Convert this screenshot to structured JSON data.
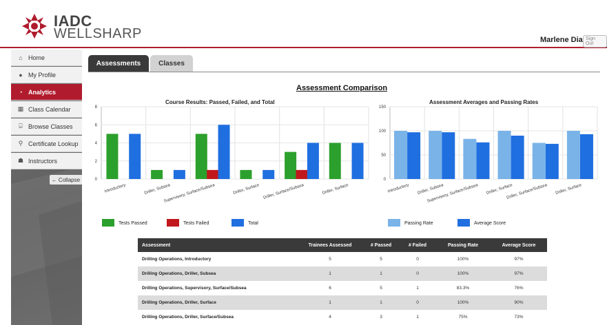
{
  "brand": {
    "line1": "IADC",
    "line2": "WELLSHARP",
    "accent": "#b01c2e"
  },
  "user": {
    "name": "Marlene Diaz",
    "signout": "Sign Out"
  },
  "sidebar": {
    "items": [
      {
        "label": "Home",
        "icon": "home-icon"
      },
      {
        "label": "My Profile",
        "icon": "user-icon"
      },
      {
        "label": "Analytics",
        "icon": "analytics-icon",
        "active": true
      },
      {
        "label": "Class Calendar",
        "icon": "calendar-icon"
      },
      {
        "label": "Browse Classes",
        "icon": "institution-icon"
      },
      {
        "label": "Certificate Lookup",
        "icon": "search-icon"
      },
      {
        "label": "Instructors",
        "icon": "users-icon"
      }
    ],
    "collapse": "Collapse"
  },
  "tabs": [
    {
      "label": "Assessments",
      "active": true
    },
    {
      "label": "Classes"
    }
  ],
  "page_title": "Assessment Comparison",
  "chart_data": [
    {
      "type": "bar",
      "title": "Course Results: Passed, Failed, and Total",
      "categories": [
        "Introductory",
        "Driller, Subsea",
        "Supervisory, Surface/Subsea",
        "Driller, Surface",
        "Driller, Surface/Subsea",
        "Driller, Surface"
      ],
      "series": [
        {
          "name": "Tests Passed",
          "color": "#2ca02c",
          "values": [
            5,
            1,
            5,
            1,
            3,
            4
          ]
        },
        {
          "name": "Tests Failed",
          "color": "#c0181c",
          "values": [
            0,
            0,
            1,
            0,
            1,
            0
          ]
        },
        {
          "name": "Total",
          "color": "#1f6fe0",
          "values": [
            5,
            1,
            6,
            1,
            4,
            4
          ]
        }
      ],
      "ylim": [
        0,
        8
      ],
      "yticks": [
        "0",
        "2",
        "4",
        "6",
        "8"
      ],
      "grid": true,
      "legend": "bottom"
    },
    {
      "type": "bar",
      "title": "Assessment Averages and Passing Rates",
      "categories": [
        "Introductory",
        "Driller, Subsea",
        "Supervisory, Surface/Subsea",
        "Driller, Surface",
        "Driller, Surface/Subsea",
        "Driller, Surface"
      ],
      "series": [
        {
          "name": "Passing Rate",
          "color": "#7ab3e8",
          "values": [
            100,
            100,
            83.3,
            100,
            75,
            100
          ]
        },
        {
          "name": "Average Score",
          "color": "#1f6fe0",
          "values": [
            97,
            97,
            76,
            90,
            73,
            93
          ]
        }
      ],
      "ylim": [
        0,
        150
      ],
      "yticks": [
        "0",
        "50",
        "100",
        "150"
      ],
      "grid": true,
      "legend": "bottom"
    }
  ],
  "table": {
    "headers": [
      "Assessment",
      "Trainees Assessed",
      "# Passed",
      "# Failed",
      "Passing Rate",
      "Average Score"
    ],
    "rows": [
      [
        "Drilling Operations, Introductory",
        "5",
        "5",
        "0",
        "100%",
        "97%"
      ],
      [
        "Drilling Operations, Driller, Subsea",
        "1",
        "1",
        "0",
        "100%",
        "97%"
      ],
      [
        "Drilling Operations, Supervisory, Surface/Subsea",
        "6",
        "5",
        "1",
        "83.3%",
        "76%"
      ],
      [
        "Drilling Operations, Driller, Surface",
        "1",
        "1",
        "0",
        "100%",
        "90%"
      ],
      [
        "Drilling Operations, Driller, Surface/Subsea",
        "4",
        "3",
        "1",
        "75%",
        "73%"
      ]
    ]
  }
}
